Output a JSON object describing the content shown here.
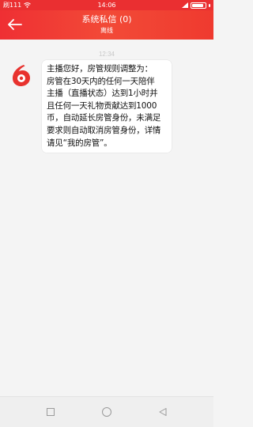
{
  "status_bar": {
    "left_text": "刷111",
    "time": "14:06",
    "icons": [
      "signal-icon",
      "wifi-icon",
      "battery-icon"
    ]
  },
  "header": {
    "title": "系统私信 (0)",
    "subtitle": "离线",
    "back_icon": "back-arrow-icon",
    "accent_color": "#ef2f33"
  },
  "chat": {
    "timestamp": "12:34",
    "messages": [
      {
        "sender_avatar": "6-logo-icon",
        "lines": [
          "主播您好，房管规则调整为：",
          "房管在30天内的任何一天陪伴",
          "主播（直播状态）达到1小时并",
          "且任何一天礼物贡献达到1000",
          "币，自动延长房管身份，未满足",
          "要求则自动取消房管身份，详情",
          "请见“我的房管”。"
        ]
      }
    ]
  },
  "nav": {
    "icons": [
      "recent-apps-icon",
      "home-icon",
      "back-triangle-icon"
    ]
  }
}
